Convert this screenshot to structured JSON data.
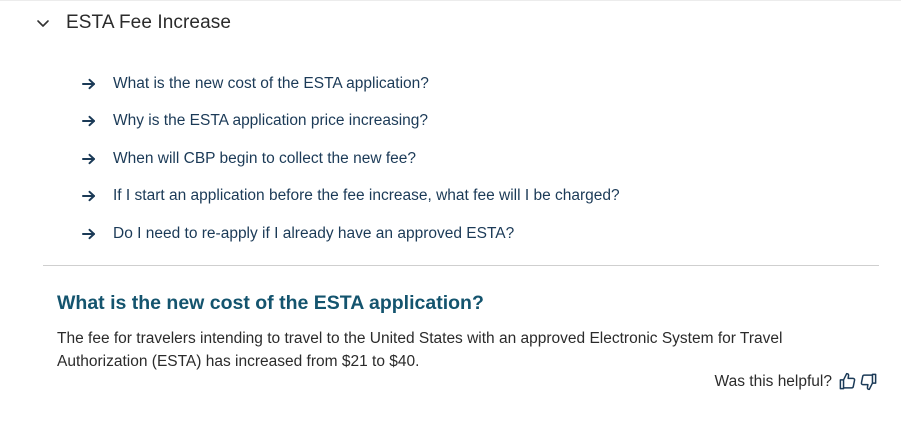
{
  "accordion": {
    "title": "ESTA Fee Increase",
    "expanded_icon": "chevron-down-icon"
  },
  "faq": {
    "link_icon": "arrow-right-icon",
    "items": [
      {
        "label": "What is the new cost of the ESTA application?"
      },
      {
        "label": "Why is the ESTA application price increasing?"
      },
      {
        "label": "When will CBP begin to collect the new fee?"
      },
      {
        "label": "If I start an application before the fee increase, what fee will I be charged?"
      },
      {
        "label": "Do I need to re-apply if I already have an approved ESTA?"
      }
    ]
  },
  "answer": {
    "title": "What is the new cost of the ESTA application?",
    "body": "The fee for travelers intending to travel to the United States with an approved Electronic System for Travel Authorization (ESTA) has increased from $21 to $40."
  },
  "feedback": {
    "label": "Was this helpful?",
    "up_icon": "thumbs-up-icon",
    "down_icon": "thumbs-down-icon"
  },
  "colors": {
    "link": "#1b3a57",
    "answer_title": "#14546e",
    "text": "#2b2b2b",
    "divider": "#cfcfcf"
  }
}
